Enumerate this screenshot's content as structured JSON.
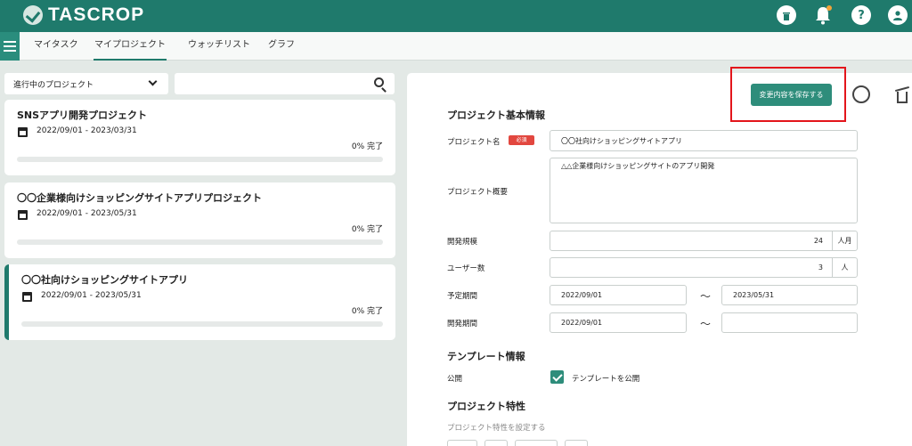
{
  "header": {
    "logo_text": "TASCROP",
    "icons": [
      "trash-icon",
      "bell-icon",
      "help-icon",
      "user-icon"
    ],
    "help_glyph": "?"
  },
  "nav": {
    "tabs": [
      {
        "label": "マイタスク",
        "active": false
      },
      {
        "label": "マイプロジェクト",
        "active": true
      },
      {
        "label": "ウォッチリスト",
        "active": false
      },
      {
        "label": "グラフ",
        "active": false
      }
    ]
  },
  "left": {
    "filter_select": "進行中のプロジェクト",
    "search_placeholder": "",
    "projects": [
      {
        "title": "SNSアプリ開発プロジェクト",
        "dates": "2022/09/01 - 2023/03/31",
        "progress_text": "0% 完了",
        "progress": 0
      },
      {
        "title": "〇〇企業様向けショッピングサイトアプリプロジェクト",
        "dates": "2022/09/01 - 2023/05/31",
        "progress_text": "0% 完了",
        "progress": 0
      },
      {
        "title": "〇〇社向けショッピングサイトアプリ",
        "dates": "2022/09/01 - 2023/05/31",
        "progress_text": "0% 完了",
        "progress": 0,
        "selected": true
      }
    ]
  },
  "form": {
    "save_button": "変更内容を保存する",
    "basic_section": "プロジェクト基本情報",
    "name_label": "プロジェクト名",
    "required_badge": "必須",
    "name_value": "〇〇社向けショッピングサイトアプリ",
    "summary_label": "プロジェクト概要",
    "summary_value": "△△企業様向けショッピングサイトのアプリ開発",
    "scale_label": "開発規模",
    "scale_value": "24",
    "scale_unit": "人月",
    "users_label": "ユーザー数",
    "users_value": "3",
    "users_unit": "人",
    "planned_label": "予定期間",
    "planned_start": "2022/09/01",
    "planned_end": "2023/05/31",
    "dev_label": "開発期間",
    "dev_start": "2022/09/01",
    "dev_end": "",
    "tilde": "～",
    "template_section": "テンプレート情報",
    "public_label": "公開",
    "public_checkbox_label": "テンプレートを公開",
    "public_checked": true,
    "traits_section": "プロジェクト特性",
    "traits_hint": "プロジェクト特性を設定する"
  },
  "colors": {
    "brand": "#1f7a6c",
    "button": "#2e8d7b",
    "required": "#e2473f",
    "highlight": "#e3151b"
  }
}
